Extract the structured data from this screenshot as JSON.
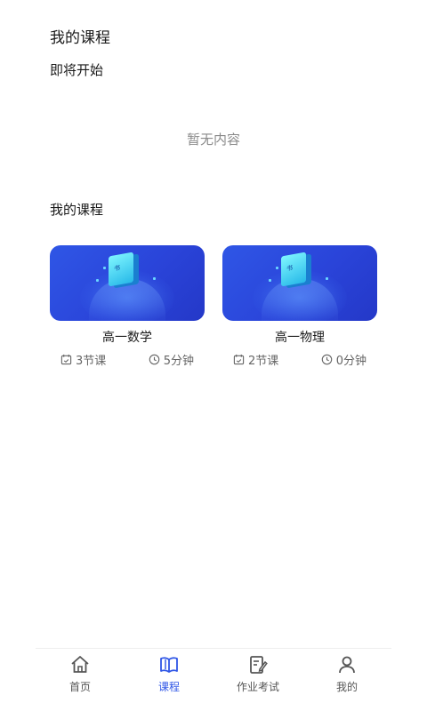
{
  "header": {
    "title": "我的课程"
  },
  "upcoming": {
    "title": "即将开始",
    "empty_text": "暂无内容"
  },
  "my_courses": {
    "title": "我的课程",
    "items": [
      {
        "name": "高一数学",
        "lessons": "3节课",
        "duration": "5分钟",
        "cover_label": "书"
      },
      {
        "name": "高一物理",
        "lessons": "2节课",
        "duration": "0分钟",
        "cover_label": "书"
      }
    ]
  },
  "tabbar": {
    "items": [
      {
        "label": "首页",
        "icon": "home-icon",
        "active": false
      },
      {
        "label": "课程",
        "icon": "book-icon",
        "active": true
      },
      {
        "label": "作业考试",
        "icon": "edit-icon",
        "active": false
      },
      {
        "label": "我的",
        "icon": "user-icon",
        "active": false
      }
    ]
  },
  "colors": {
    "accent": "#2f56e6",
    "muted_text": "#8a8a8a",
    "cover_gradient_start": "#2f56e6",
    "cover_gradient_end": "#2438c8"
  }
}
